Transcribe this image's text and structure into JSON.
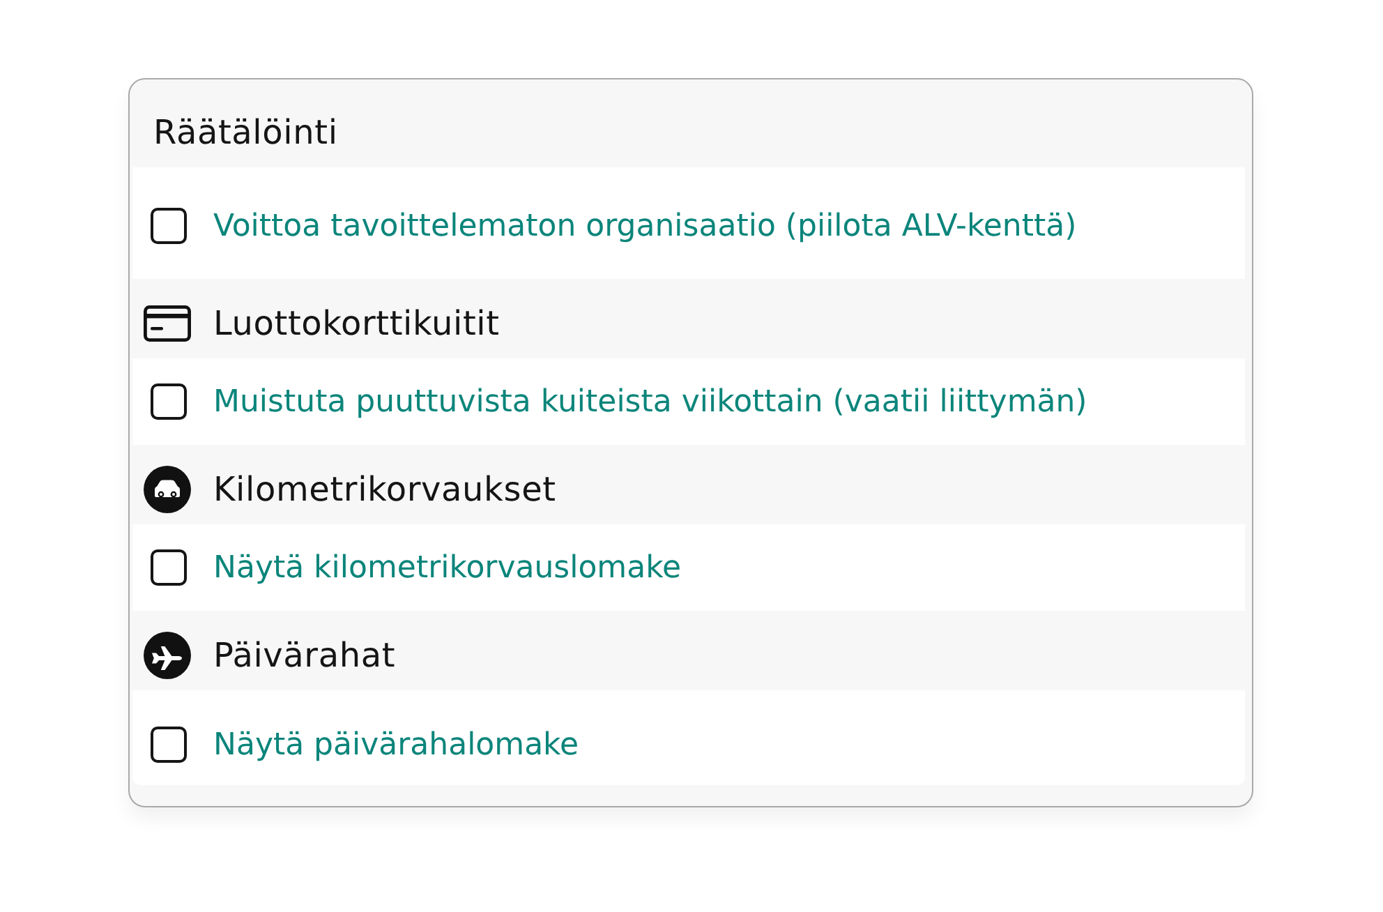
{
  "card": {
    "title": "Räätälöinti",
    "options": [
      {
        "label": "Voittoa tavoittelematon organisaatio (piilota ALV-kenttä)",
        "checked": false
      }
    ]
  },
  "sections": [
    {
      "kind": "card",
      "heading": "Luottokorttikuitit",
      "options": [
        {
          "label": "Muistuta puuttuvista kuiteista viikottain (vaatii liittymän)",
          "checked": false
        }
      ]
    },
    {
      "kind": "car",
      "heading": "Kilometrikorvaukset",
      "options": [
        {
          "label": "Näytä kilometrikorvauslomake",
          "checked": false
        }
      ]
    },
    {
      "kind": "plane",
      "heading": "Päivärahat",
      "options": [
        {
          "label": "Näytä päivärahalomake",
          "checked": false
        }
      ]
    }
  ]
}
